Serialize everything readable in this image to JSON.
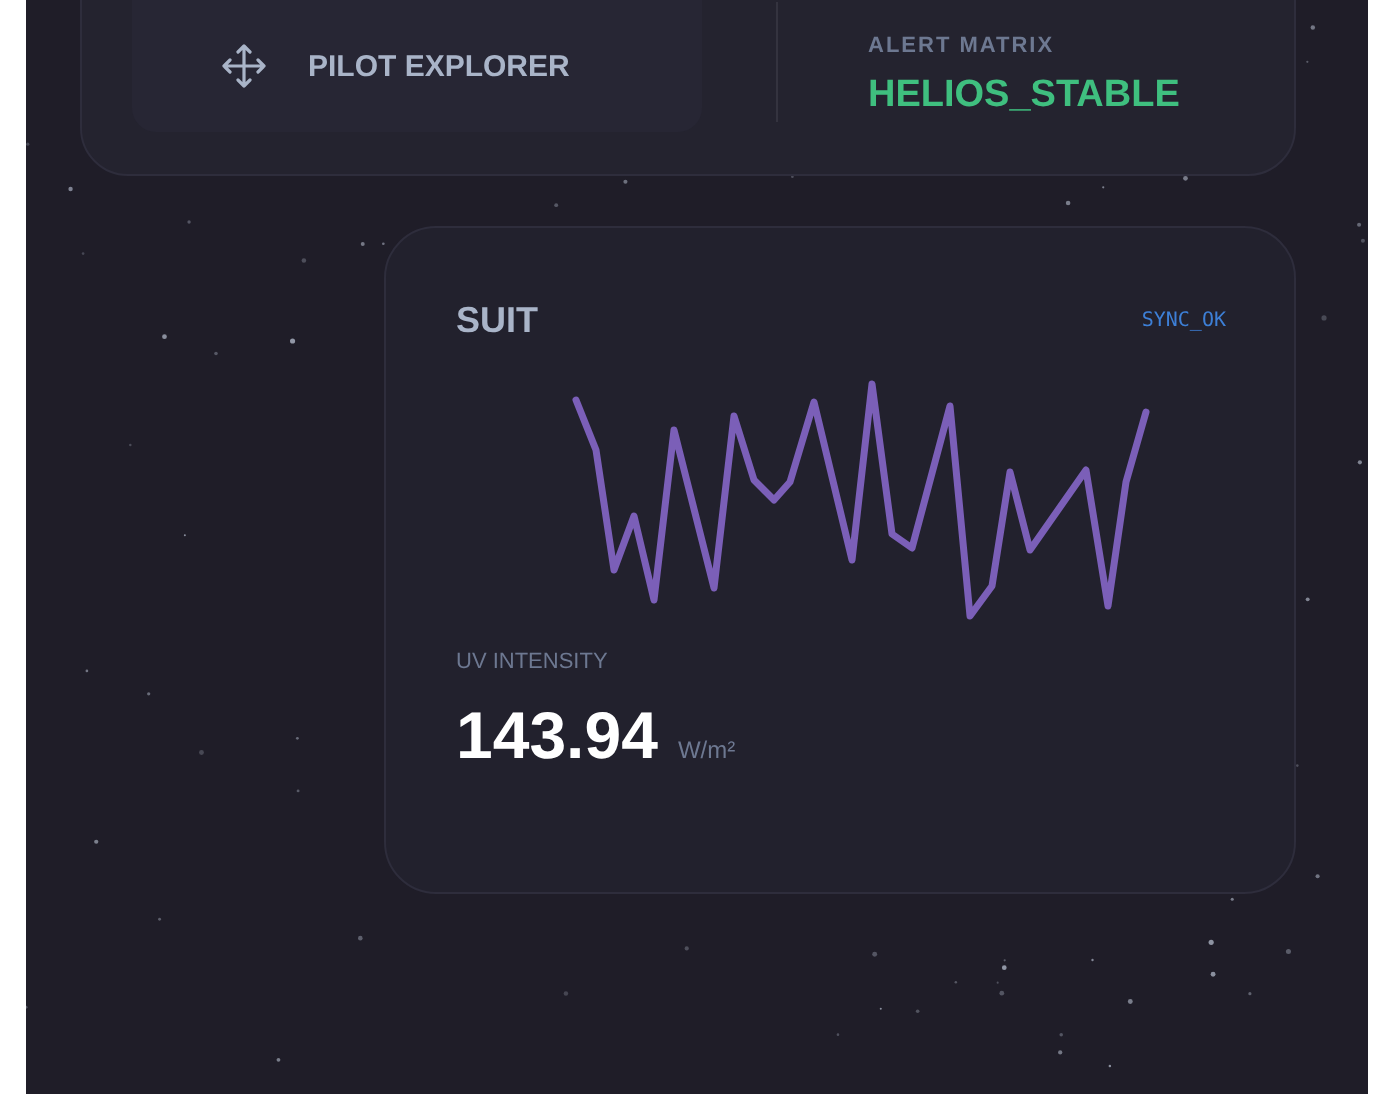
{
  "top_panel": {
    "pilot_button": {
      "label": "PILOT EXPLORER"
    },
    "alert": {
      "label": "ALERT MATRIX",
      "value": "HELIOS_STABLE"
    }
  },
  "suit_card": {
    "title": "SUIT",
    "status": "SYNC_OK",
    "metric": {
      "label": "UV INTENSITY",
      "value": "143.94",
      "unit": "W/m²"
    }
  }
}
